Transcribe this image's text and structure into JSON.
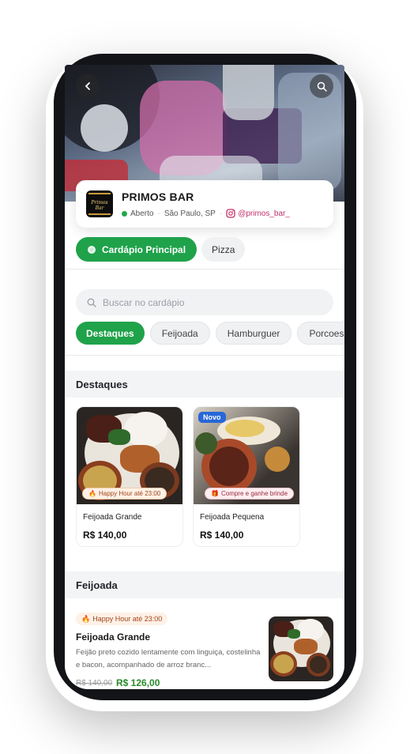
{
  "store": {
    "name": "PRIMOS BAR",
    "logo_text": "Primos Bar",
    "status": "Aberto",
    "location": "São Paulo, SP",
    "instagram": "@primos_bar_"
  },
  "menu_tabs": {
    "primary": "Cardápio Principal",
    "secondary": "Pizza"
  },
  "search": {
    "placeholder": "Buscar no cardápio"
  },
  "categories": [
    "Destaques",
    "Feijoada",
    "Hamburguer",
    "Porcoes"
  ],
  "sections": {
    "featured": "Destaques",
    "feijoada": "Feijoada"
  },
  "featured_items": [
    {
      "name": "Feijoada Grande",
      "price": "R$ 140,00",
      "tag": "Happy Hour até 23:00"
    },
    {
      "name": "Feijoada Pequena",
      "price": "R$ 140,00",
      "tag": "Compre e ganhe brinde",
      "badge": "Novo"
    }
  ],
  "list_item": {
    "tag": "Happy Hour até 23:00",
    "name": "Feijoada Grande",
    "description": "Feijão preto cozido lentamente com linguiça, costelinha e bacon, acompanhado de arroz branc...",
    "old_price": "R$ 140,00",
    "price": "R$ 126,00"
  },
  "colors": {
    "accent_green": "#1fa24a",
    "open_status": "#22a84a",
    "instagram": "#c2306b",
    "new_badge": "#2767d8"
  }
}
